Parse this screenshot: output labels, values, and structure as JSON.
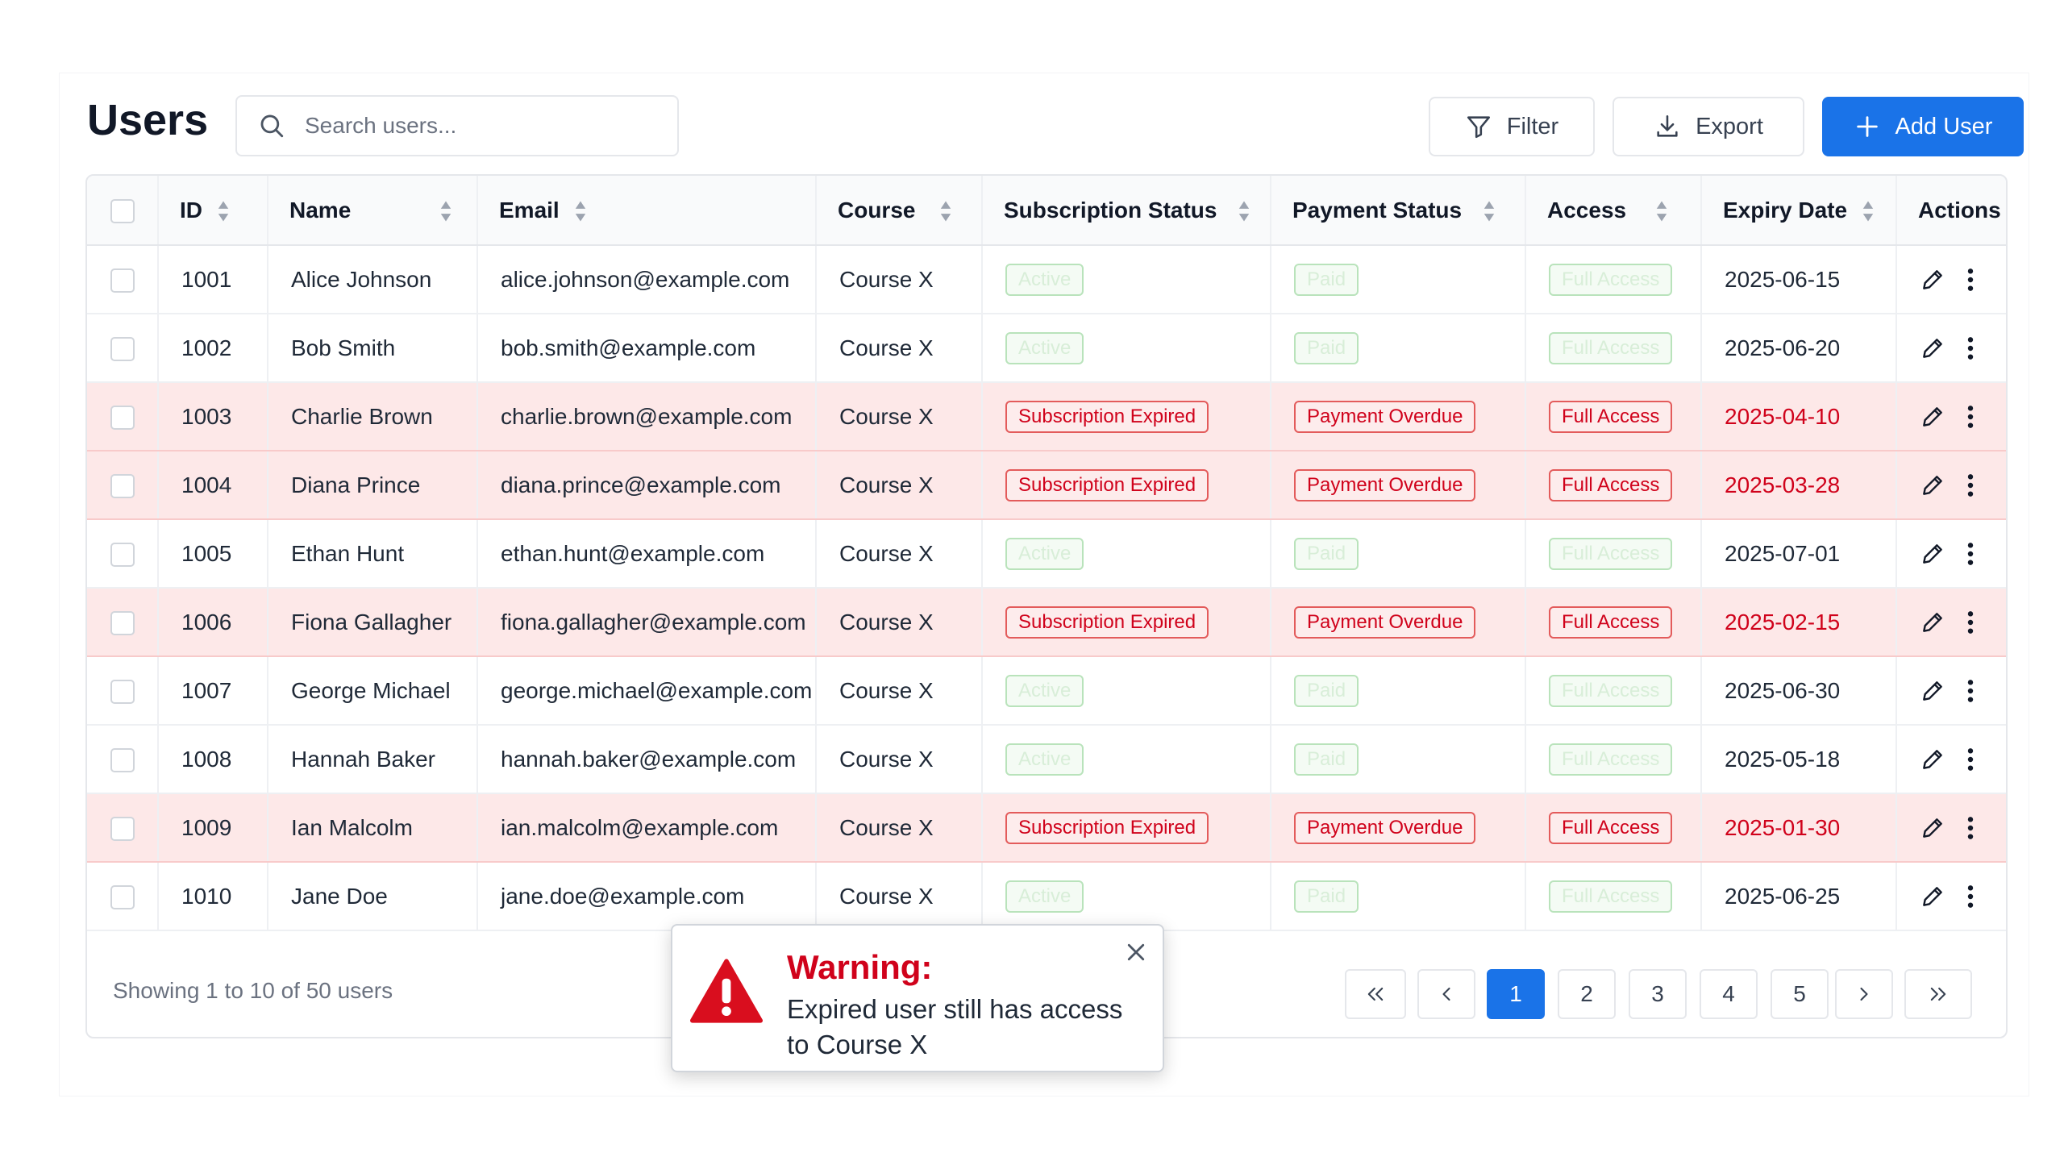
{
  "header": {
    "title": "Users",
    "search_placeholder": "Search users...",
    "filter_label": "Filter",
    "export_label": "Export",
    "add_label": "Add User"
  },
  "table": {
    "columns": [
      "ID",
      "Name",
      "Email",
      "Course",
      "Subscription Status",
      "Payment Status",
      "Access",
      "Expiry Date",
      "Actions"
    ],
    "rows": [
      {
        "id": "1001",
        "name": "Alice Johnson",
        "email": "alice.johnson@example.com",
        "course": "Course X",
        "sub": "Active",
        "pay": "Paid",
        "access": "Full Access",
        "expiry": "2025-06-15",
        "expired": false
      },
      {
        "id": "1002",
        "name": "Bob Smith",
        "email": "bob.smith@example.com",
        "course": "Course X",
        "sub": "Active",
        "pay": "Paid",
        "access": "Full Access",
        "expiry": "2025-06-20",
        "expired": false
      },
      {
        "id": "1003",
        "name": "Charlie Brown",
        "email": "charlie.brown@example.com",
        "course": "Course X",
        "sub": "Subscription Expired",
        "pay": "Payment Overdue",
        "access": "Full Access",
        "expiry": "2025-04-10",
        "expired": true
      },
      {
        "id": "1004",
        "name": "Diana Prince",
        "email": "diana.prince@example.com",
        "course": "Course X",
        "sub": "Subscription Expired",
        "pay": "Payment Overdue",
        "access": "Full Access",
        "expiry": "2025-03-28",
        "expired": true
      },
      {
        "id": "1005",
        "name": "Ethan Hunt",
        "email": "ethan.hunt@example.com",
        "course": "Course X",
        "sub": "Active",
        "pay": "Paid",
        "access": "Full Access",
        "expiry": "2025-07-01",
        "expired": false
      },
      {
        "id": "1006",
        "name": "Fiona Gallagher",
        "email": "fiona.gallagher@example.com",
        "course": "Course X",
        "sub": "Subscription Expired",
        "pay": "Payment Overdue",
        "access": "Full Access",
        "expiry": "2025-02-15",
        "expired": true
      },
      {
        "id": "1007",
        "name": "George Michael",
        "email": "george.michael@example.com",
        "course": "Course X",
        "sub": "Active",
        "pay": "Paid",
        "access": "Full Access",
        "expiry": "2025-06-30",
        "expired": false
      },
      {
        "id": "1008",
        "name": "Hannah Baker",
        "email": "hannah.baker@example.com",
        "course": "Course X",
        "sub": "Active",
        "pay": "Paid",
        "access": "Full Access",
        "expiry": "2025-05-18",
        "expired": false
      },
      {
        "id": "1009",
        "name": "Ian Malcolm",
        "email": "ian.malcolm@example.com",
        "course": "Course X",
        "sub": "Subscription Expired",
        "pay": "Payment Overdue",
        "access": "Full Access",
        "expiry": "2025-01-30",
        "expired": true
      },
      {
        "id": "1010",
        "name": "Jane Doe",
        "email": "jane.doe@example.com",
        "course": "Course X",
        "sub": "Active",
        "pay": "Paid",
        "access": "Full Access",
        "expiry": "2025-06-25",
        "expired": false
      }
    ]
  },
  "footer": {
    "showing": "Showing 1 to 10 of 50 users",
    "pages": [
      "1",
      "2",
      "3",
      "4",
      "5"
    ],
    "current_page": "1"
  },
  "toast": {
    "title": "Warning:",
    "message": "Expired user still has access to Course X"
  },
  "colors": {
    "primary": "#1a73e8",
    "danger": "#d0021b",
    "expired_row": "#fde8e8"
  },
  "icons": {
    "search": "search-icon",
    "filter": "filter-icon",
    "export": "download-icon",
    "add": "plus-icon",
    "sort": "sort-icon",
    "edit": "pencil-icon",
    "more": "more-vertical-icon",
    "warning": "warning-icon",
    "close": "close-icon"
  }
}
